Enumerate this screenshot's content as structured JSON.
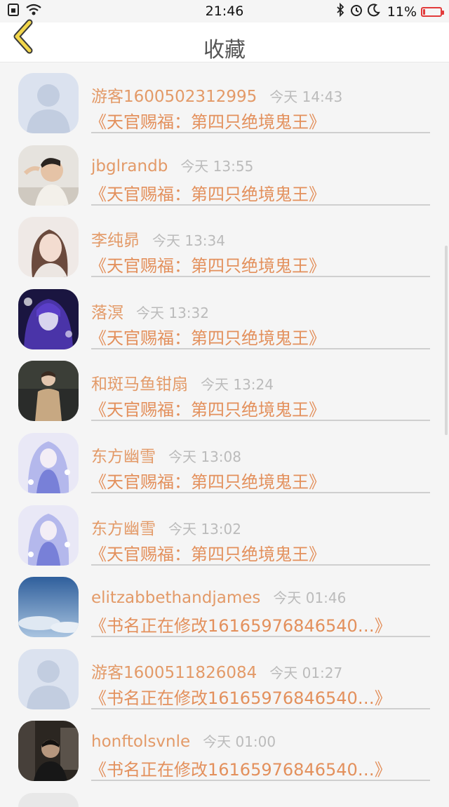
{
  "status_bar": {
    "time": "21:46",
    "battery_text": "11%",
    "battery_level": 0.11
  },
  "header": {
    "title": "收藏"
  },
  "colors": {
    "accent": "#e3905c",
    "time_gray": "#bbbbbb",
    "battery_red": "#e23b3b"
  },
  "items": [
    {
      "name": "游客1600502312995",
      "time": "今天 14:43",
      "book": "《天官赐福：第四只绝境鬼王》",
      "avatar": "default"
    },
    {
      "name": "jbglrandb",
      "time": "今天 13:55",
      "book": "《天官赐福：第四只绝境鬼王》",
      "avatar": "photo-man"
    },
    {
      "name": "李纯昴",
      "time": "今天 13:34",
      "book": "《天官赐福：第四只绝境鬼王》",
      "avatar": "photo-woman"
    },
    {
      "name": "落溟",
      "time": "今天 13:32",
      "book": "《天官赐福：第四只绝境鬼王》",
      "avatar": "anime-purple"
    },
    {
      "name": "和斑马鱼钳扇",
      "time": "今天 13:24",
      "book": "《天官赐福：第四只绝境鬼王》",
      "avatar": "photo-man-standing"
    },
    {
      "name": "东方幽雪",
      "time": "今天 13:08",
      "book": "《天官赐福：第四只绝境鬼王》",
      "avatar": "anime-light"
    },
    {
      "name": "东方幽雪",
      "time": "今天 13:02",
      "book": "《天官赐福：第四只绝境鬼王》",
      "avatar": "anime-light"
    },
    {
      "name": "elitzabbethandjames",
      "time": "今天 01:46",
      "book": "《书名正在修改16165976846540…》",
      "avatar": "sky"
    },
    {
      "name": "游客1600511826084",
      "time": "今天 01:27",
      "book": "《书名正在修改16165976846540…》",
      "avatar": "default"
    },
    {
      "name": "honftolsvnle",
      "time": "今天 01:00",
      "book": "《书名正在修改16165976846540…》",
      "avatar": "photo-dark"
    }
  ]
}
